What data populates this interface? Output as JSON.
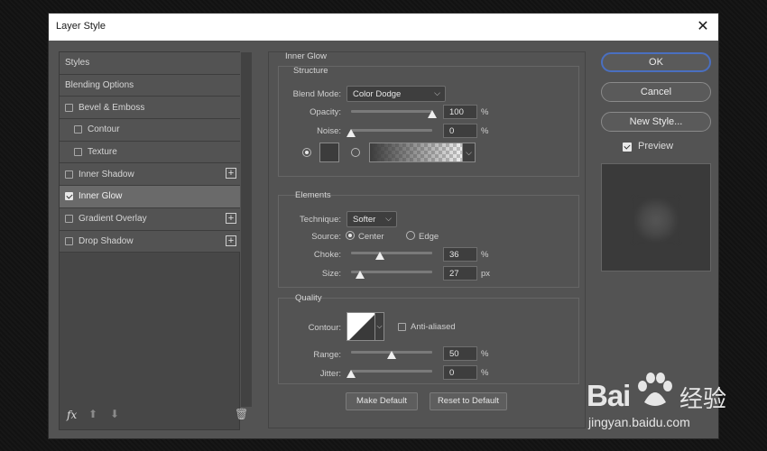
{
  "dialog": {
    "title": "Layer Style",
    "close_glyph": "✕"
  },
  "styles_list": [
    {
      "label": "Styles",
      "checkbox": false,
      "indent": false,
      "checked": false,
      "plus": false,
      "selected": false
    },
    {
      "label": "Blending Options",
      "checkbox": false,
      "indent": false,
      "checked": false,
      "plus": false,
      "selected": false
    },
    {
      "label": "Bevel & Emboss",
      "checkbox": true,
      "indent": false,
      "checked": false,
      "plus": false,
      "selected": false
    },
    {
      "label": "Contour",
      "checkbox": true,
      "indent": true,
      "checked": false,
      "plus": false,
      "selected": false
    },
    {
      "label": "Texture",
      "checkbox": true,
      "indent": true,
      "checked": false,
      "plus": false,
      "selected": false
    },
    {
      "label": "Inner Shadow",
      "checkbox": true,
      "indent": false,
      "checked": false,
      "plus": true,
      "selected": false
    },
    {
      "label": "Inner Glow",
      "checkbox": true,
      "indent": false,
      "checked": true,
      "plus": false,
      "selected": true
    },
    {
      "label": "Gradient Overlay",
      "checkbox": true,
      "indent": false,
      "checked": false,
      "plus": true,
      "selected": false
    },
    {
      "label": "Drop Shadow",
      "checkbox": true,
      "indent": false,
      "checked": false,
      "plus": true,
      "selected": false
    }
  ],
  "left_footer": {
    "fx": "fx",
    "up": "⬆",
    "down": "⬇",
    "trash": "🗑"
  },
  "inner_glow": {
    "section_title": "Inner Glow",
    "structure": {
      "title": "Structure",
      "blend_mode_label": "Blend Mode:",
      "blend_mode_value": "Color Dodge",
      "opacity_label": "Opacity:",
      "opacity_value": "100",
      "opacity_unit": "%",
      "opacity_level": 1.0,
      "noise_label": "Noise:",
      "noise_value": "0",
      "noise_unit": "%",
      "noise_level": 0.0
    },
    "elements": {
      "title": "Elements",
      "technique_label": "Technique:",
      "technique_value": "Softer",
      "source_label": "Source:",
      "source_center": "Center",
      "source_edge": "Edge",
      "choke_label": "Choke:",
      "choke_value": "36",
      "choke_unit": "%",
      "choke_level": 0.36,
      "size_label": "Size:",
      "size_value": "27",
      "size_unit": "px",
      "size_level": 0.11
    },
    "quality": {
      "title": "Quality",
      "contour_label": "Contour:",
      "anti_aliased_label": "Anti-aliased",
      "range_label": "Range:",
      "range_value": "50",
      "range_unit": "%",
      "range_level": 0.5,
      "jitter_label": "Jitter:",
      "jitter_value": "0",
      "jitter_unit": "%",
      "jitter_level": 0.0
    },
    "make_default": "Make Default",
    "reset_default": "Reset to Default"
  },
  "right": {
    "ok": "OK",
    "cancel": "Cancel",
    "new_style": "New Style...",
    "preview_label": "Preview",
    "preview_checked": true
  },
  "watermark": {
    "logo": "Bai",
    "cn": "经验",
    "url": "jingyan.baidu.com"
  },
  "colors": {
    "dialog_bg": "#535353",
    "ok_border": "#4a6fc0",
    "selected_row": "#6a6a6a"
  }
}
